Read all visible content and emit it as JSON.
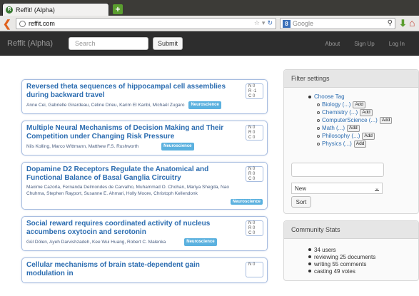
{
  "browser": {
    "tab_title": "Reffit! (Alpha)",
    "favicon_letter": "R",
    "new_tab_symbol": "+",
    "url": "reffit.com",
    "search_placeholder": "Google",
    "search_engine_letter": "8"
  },
  "site": {
    "brand": "Reffit (Alpha)",
    "search_placeholder": "Search",
    "submit_label": "Submit",
    "nav": {
      "about": "About",
      "signup": "Sign Up",
      "login": "Log In"
    }
  },
  "papers": [
    {
      "title": "Reversed theta sequences of hippocampal cell assemblies during backward travel",
      "authors": "Anne Cei, Gabrielle Girardeau, Céline Drieu, Karim El Kanbi, Michaël Zugaro",
      "tag": "Neuroscience",
      "score": [
        "N 0",
        "R -1",
        "C 0"
      ]
    },
    {
      "title": "Multiple Neural Mechanisms of Decision Making and Their Competition under Changing Risk Pressure",
      "authors": "Nils Kolling, Marco Wittmann, Matthew F.S. Rushworth",
      "tag": "Neuroscience",
      "score": [
        "N 0",
        "R 0",
        "C 0"
      ]
    },
    {
      "title": "Dopamine D2 Receptors Regulate the Anatomical and Functional Balance of Basal Ganglia Circuitry",
      "authors": "Maxime Cazorla, Fernanda Delmondes de Carvalho, Muhammad O. Chohan, Mariya Shegda, Nao Chuhma, Stephen Rayport, Susanne E. Ahmari, Holly Moore, Christoph Kellendonk",
      "tag": "Neuroscience",
      "score": [
        "N 0",
        "R 0",
        "C 0"
      ]
    },
    {
      "title": "Social reward requires coordinated activity of nucleus accumbens oxytocin and serotonin",
      "authors": "Gül Dölen, Ayeh Darvishzadeh, Kee Wui Huang, Robert C. Malenka",
      "tag": "Neuroscience",
      "score": [
        "N 0",
        "R 0",
        "C 0"
      ]
    },
    {
      "title": "Cellular mechanisms of brain state-dependent gain modulation in",
      "authors": "",
      "tag": "",
      "score": [
        "N 0",
        "",
        ""
      ]
    }
  ],
  "filter": {
    "heading": "Filter settings",
    "choose_tag": "Choose Tag",
    "add_label": "Add",
    "tags": [
      "Biology (...)",
      "Chemistry (...)",
      "ComputerScience (...)",
      "Math (...)",
      "Philosophy (...)",
      "Physics (...)"
    ],
    "sort_value": "New",
    "sort_arrow": "⌄",
    "sort_label": "Sort"
  },
  "stats": {
    "heading": "Community Stats",
    "items": [
      "34 users",
      "reviewing 25 documents",
      "writing 55 comments",
      "casting 49 votes"
    ]
  }
}
